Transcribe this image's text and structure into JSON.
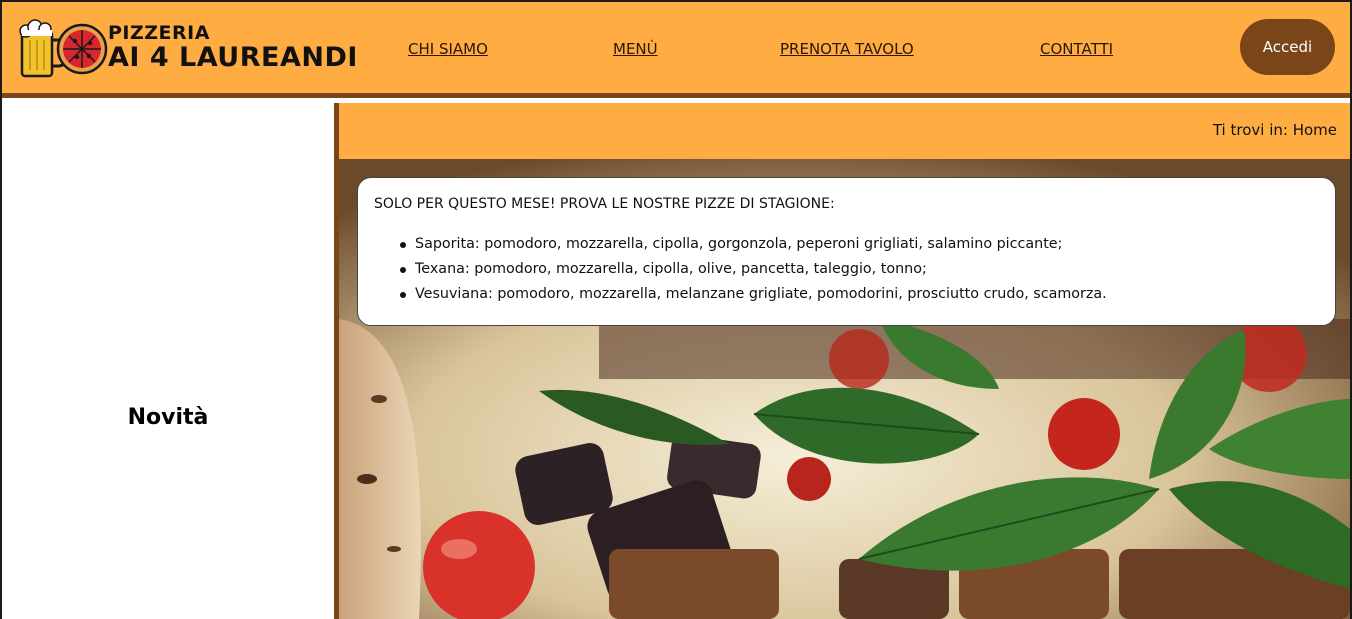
{
  "brand": {
    "line1": "PIZZERIA",
    "line2": "AI 4 LAUREANDI",
    "colors": {
      "primary": "#ffad42",
      "accent": "#7a4519"
    }
  },
  "nav": {
    "items": [
      {
        "label": "CHI SIAMO"
      },
      {
        "label": "MENÙ"
      },
      {
        "label": "PRENOTA TAVOLO"
      },
      {
        "label": "CONTATTI"
      }
    ]
  },
  "header": {
    "login_label": "Accedi"
  },
  "sidebar": {
    "title": "Novità"
  },
  "breadcrumb": {
    "text": "Ti trovi in: Home"
  },
  "promo": {
    "title": "SOLO PER QUESTO MESE! PROVA LE NOSTRE PIZZE DI STAGIONE:",
    "items": [
      "Saporita: pomodoro, mozzarella, cipolla, gorgonzola, peperoni grigliati, salamino piccante;",
      "Texana: pomodoro, mozzarella, cipolla, olive, pancetta, taleggio, tonno;",
      "Vesuviana: pomodoro, mozzarella, melanzane grigliate, pomodorini, prosciutto crudo, scamorza."
    ]
  },
  "hero": {
    "image": "pizza-photo"
  }
}
